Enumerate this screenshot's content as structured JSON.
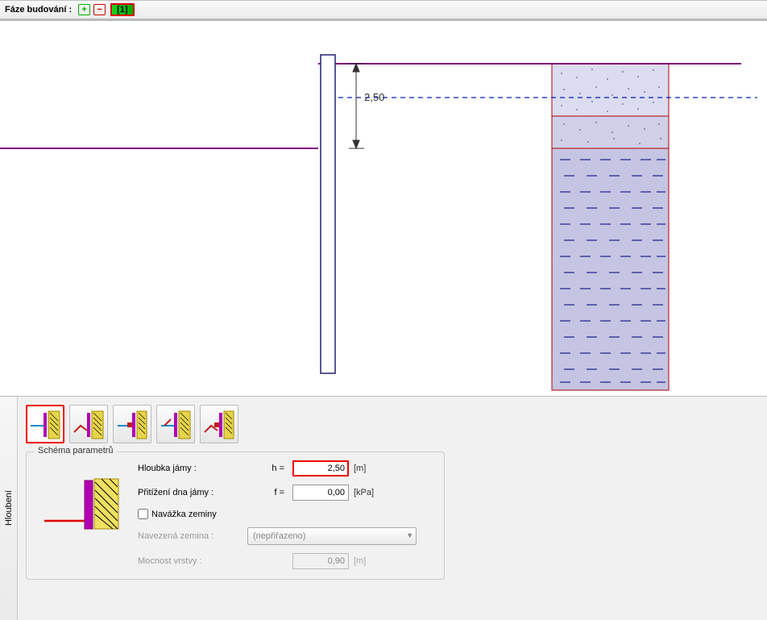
{
  "toolbar": {
    "label": "Fáze budování :",
    "add": "+",
    "remove": "−",
    "stage": "[1]"
  },
  "canvas": {
    "depth_label": "2,50"
  },
  "sideTab": "Hloubení",
  "group": {
    "title": "Schéma parametrů"
  },
  "fields": {
    "depth_label": "Hloubka jámy :",
    "depth_sym": "h =",
    "depth_val": "2,50",
    "depth_unit": "[m]",
    "surcharge_label": "Přitížení dna jámy :",
    "surcharge_sym": "f =",
    "surcharge_val": "0,00",
    "surcharge_unit": "[kPa]",
    "fill_checkbox": "Navážka zeminy",
    "fill_soil_label": "Navezená zemina :",
    "fill_soil_value": "(nepřiřazeno)",
    "fill_thk_label": "Mocnost vrstvy :",
    "fill_thk_val": "0,90",
    "fill_thk_unit": "[m]"
  }
}
